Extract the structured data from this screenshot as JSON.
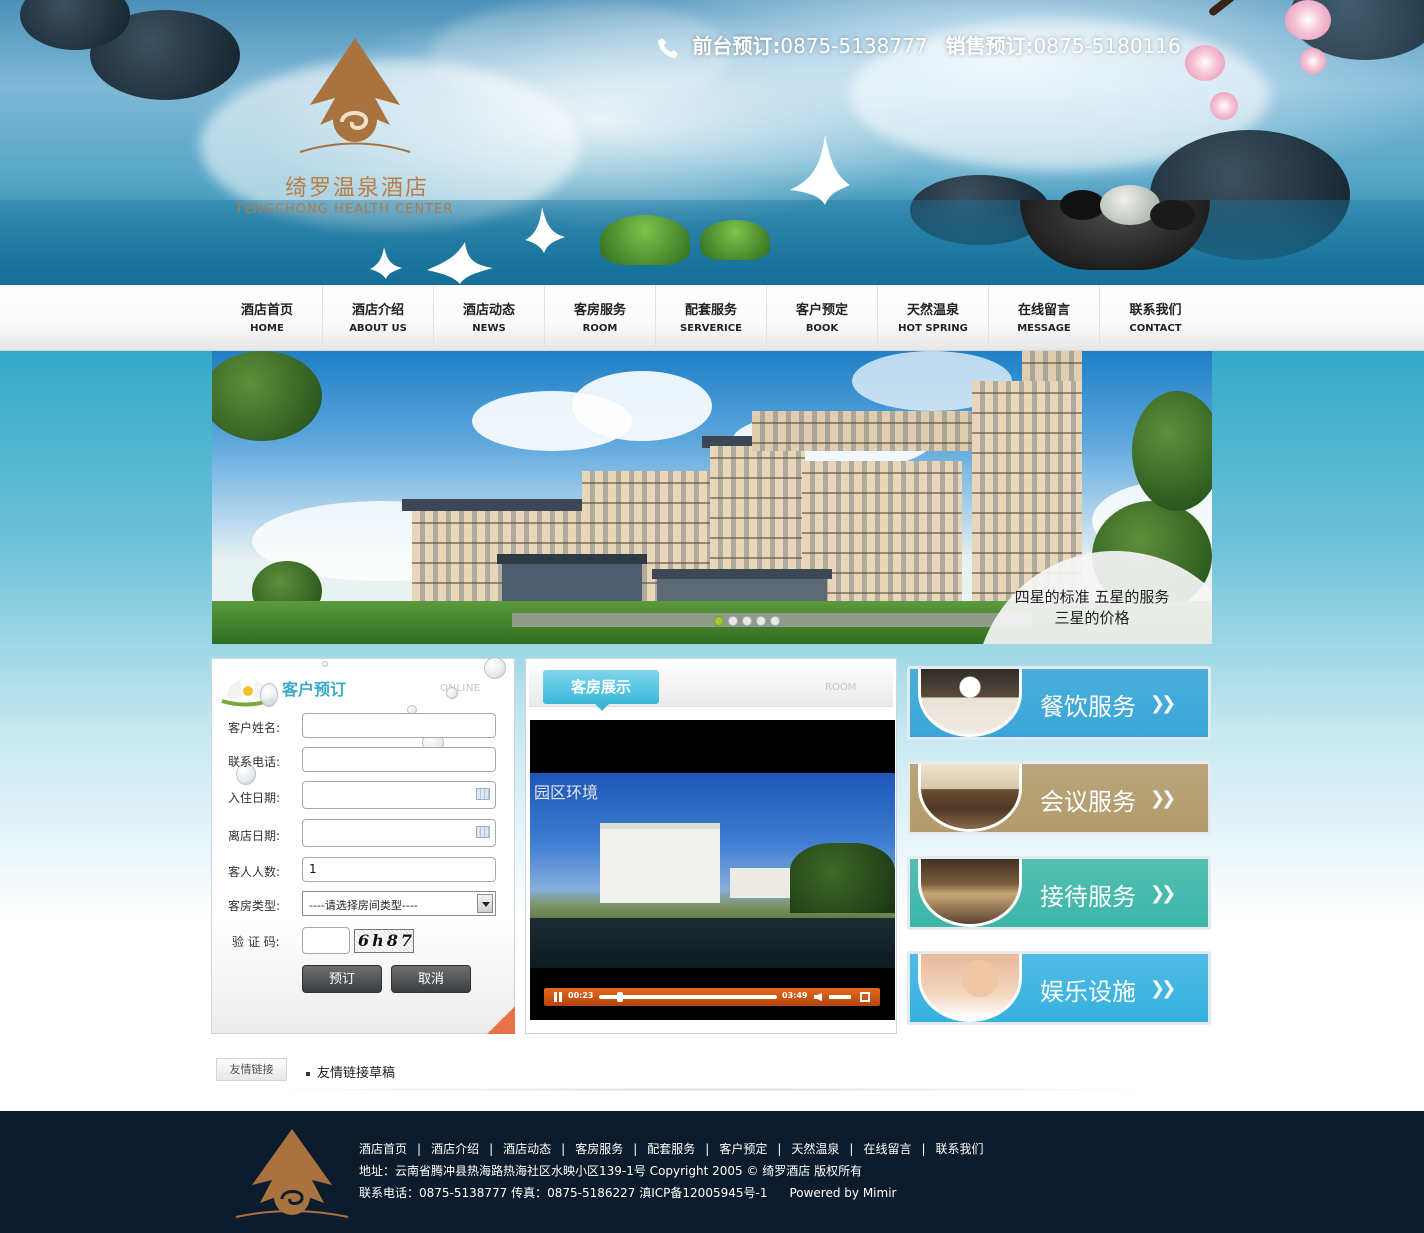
{
  "header": {
    "logo_cn": "绮罗温泉酒店",
    "logo_en": "TENGCHONG HEALTH CENTER",
    "front_desk_label": "前台预订:",
    "front_desk_phone": "0875-5138777",
    "sales_label": "销售预订:",
    "sales_phone": "0875-5180116"
  },
  "nav": [
    {
      "cn": "酒店首页",
      "en": "HOME"
    },
    {
      "cn": "酒店介绍",
      "en": "ABOUT US"
    },
    {
      "cn": "酒店动态",
      "en": "NEWS"
    },
    {
      "cn": "客房服务",
      "en": "ROOM"
    },
    {
      "cn": "配套服务",
      "en": "SERVERICE"
    },
    {
      "cn": "客户预定",
      "en": "BOOK"
    },
    {
      "cn": "天然温泉",
      "en": "HOT SPRING"
    },
    {
      "cn": "在线留言",
      "en": "MESSAGE"
    },
    {
      "cn": "联系我们",
      "en": "CONTACT"
    }
  ],
  "banner": {
    "slogan_line1": "四星的标准 五星的服务",
    "slogan_line2": "三星的价格",
    "slide_count": 5,
    "active_slide": 1
  },
  "booking": {
    "title": "客户预订",
    "subtitle_en": "ONLINE",
    "fields": {
      "name_label": "客户姓名:",
      "phone_label": "联系电话:",
      "checkin_label": "入住日期:",
      "checkout_label": "离店日期:",
      "guests_label": "客人人数:",
      "guests_value": "1",
      "roomtype_label": "客房类型:",
      "roomtype_value": "----请选择房间类型----",
      "captcha_label": "验 证 码:",
      "captcha_code": "6h87"
    },
    "submit_label": "预订",
    "cancel_label": "取消"
  },
  "room": {
    "title": "客房展示",
    "subtitle_en": "ROOM",
    "video_caption": "园区环境",
    "current_time": "00:23",
    "duration": "03:49",
    "progress_fraction": 0.1
  },
  "services": [
    {
      "label": "餐饮服务",
      "color": "#3aa6d8"
    },
    {
      "label": "会议服务",
      "color": "#b39a6a"
    },
    {
      "label": "接待服务",
      "color": "#3bb6a8"
    },
    {
      "label": "娱乐设施",
      "color": "#35b1df"
    }
  ],
  "links": {
    "tag": "友情链接",
    "item": "友情链接草稿"
  },
  "footer": {
    "nav": [
      "酒店首页",
      "酒店介绍",
      "酒店动态",
      "客房服务",
      "配套服务",
      "客户预定",
      "天然温泉",
      "在线留言",
      "联系我们"
    ],
    "address": "地址：云南省腾冲县热海路热海社区水映小区139-1号 Copyright 2005 © 绮罗酒店 版权所有",
    "contact": "联系电话：0875-5138777 传真：0875-5186227 滇ICP备12005945号-1",
    "powered": "Powered by Mimir"
  }
}
